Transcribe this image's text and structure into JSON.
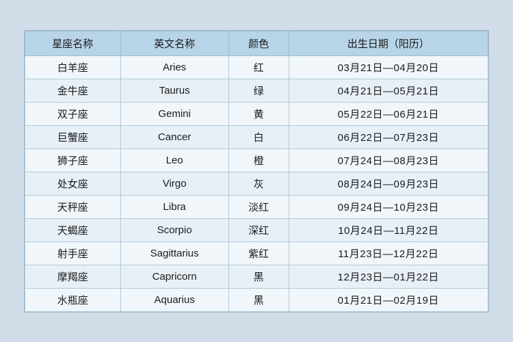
{
  "table": {
    "headers": [
      "星座名称",
      "英文名称",
      "颜色",
      "出生日期（阳历）"
    ],
    "rows": [
      [
        "白羊座",
        "Aries",
        "红",
        "03月21日—04月20日"
      ],
      [
        "金牛座",
        "Taurus",
        "绿",
        "04月21日—05月21日"
      ],
      [
        "双子座",
        "Gemini",
        "黄",
        "05月22日—06月21日"
      ],
      [
        "巨蟹座",
        "Cancer",
        "白",
        "06月22日—07月23日"
      ],
      [
        "狮子座",
        "Leo",
        "橙",
        "07月24日—08月23日"
      ],
      [
        "处女座",
        "Virgo",
        "灰",
        "08月24日—09月23日"
      ],
      [
        "天秤座",
        "Libra",
        "淡红",
        "09月24日—10月23日"
      ],
      [
        "天蝎座",
        "Scorpio",
        "深红",
        "10月24日—11月22日"
      ],
      [
        "射手座",
        "Sagittarius",
        "紫红",
        "11月23日—12月22日"
      ],
      [
        "摩羯座",
        "Capricorn",
        "黑",
        "12月23日—01月22日"
      ],
      [
        "水瓶座",
        "Aquarius",
        "黑",
        "01月21日—02月19日"
      ]
    ]
  }
}
